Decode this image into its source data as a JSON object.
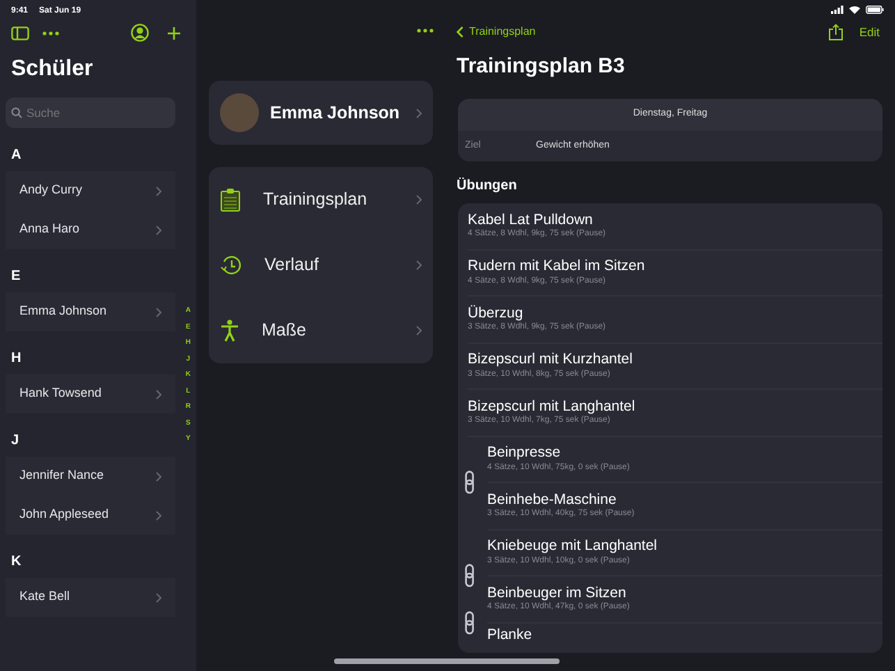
{
  "status_bar": {
    "time": "9:41",
    "date": "Sat Jun 19"
  },
  "sidebar": {
    "title": "Schüler",
    "search": {
      "placeholder": "Suche"
    },
    "sections": [
      {
        "letter": "A",
        "students": [
          "Andy Curry",
          "Anna Haro"
        ]
      },
      {
        "letter": "E",
        "students": [
          "Emma Johnson"
        ]
      },
      {
        "letter": "H",
        "students": [
          "Hank Towsend"
        ]
      },
      {
        "letter": "J",
        "students": [
          "Jennifer Nance",
          "John Appleseed"
        ]
      },
      {
        "letter": "K",
        "students": [
          "Kate Bell"
        ]
      }
    ],
    "index": [
      "A",
      "E",
      "H",
      "J",
      "K",
      "L",
      "R",
      "S",
      "Y"
    ]
  },
  "student": {
    "name": "Emma Johnson",
    "menu": [
      {
        "kind": "plan",
        "label": "Trainingsplan"
      },
      {
        "kind": "history",
        "label": "Verlauf"
      },
      {
        "kind": "measures",
        "label": "Maße"
      }
    ]
  },
  "detail": {
    "back": "Trainingsplan",
    "edit": "Edit",
    "title": "Trainingsplan B3",
    "days": "Dienstag, Freitag",
    "goal_label": "Ziel",
    "goal": "Gewicht erhöhen",
    "section": "Übungen",
    "exercises": [
      {
        "kind": "single",
        "items": [
          {
            "name": "Kabel Lat Pulldown",
            "detail": "4 Sätze, 8 Wdhl, 9kg, 75 sek (Pause)"
          }
        ]
      },
      {
        "kind": "single",
        "items": [
          {
            "name": "Rudern mit Kabel im Sitzen",
            "detail": "4 Sätze, 8 Wdhl, 9kg, 75 sek (Pause)"
          }
        ]
      },
      {
        "kind": "single",
        "items": [
          {
            "name": "Überzug",
            "detail": "3 Sätze, 8 Wdhl, 9kg, 75 sek (Pause)"
          }
        ]
      },
      {
        "kind": "single",
        "items": [
          {
            "name": "Bizepscurl mit Kurzhantel",
            "detail": "3 Sätze, 10 Wdhl, 8kg, 75 sek (Pause)"
          }
        ]
      },
      {
        "kind": "single",
        "items": [
          {
            "name": "Bizepscurl mit Langhantel",
            "detail": "3 Sätze, 10 Wdhl, 7kg, 75 sek (Pause)"
          }
        ]
      },
      {
        "kind": "superset",
        "items": [
          {
            "name": "Beinpresse",
            "detail": "4 Sätze, 10 Wdhl, 75kg, 0 sek (Pause)"
          },
          {
            "name": "Beinhebe-Maschine",
            "detail": "3 Sätze, 10 Wdhl, 40kg, 75 sek (Pause)"
          }
        ]
      },
      {
        "kind": "superset",
        "items": [
          {
            "name": "Kniebeuge mit Langhantel",
            "detail": "3 Sätze, 10 Wdhl, 10kg, 0 sek (Pause)"
          },
          {
            "name": "Beinbeuger im Sitzen",
            "detail": "4 Sätze, 10 Wdhl, 47kg, 0 sek (Pause)"
          },
          {
            "name": "Planke"
          }
        ]
      }
    ]
  }
}
